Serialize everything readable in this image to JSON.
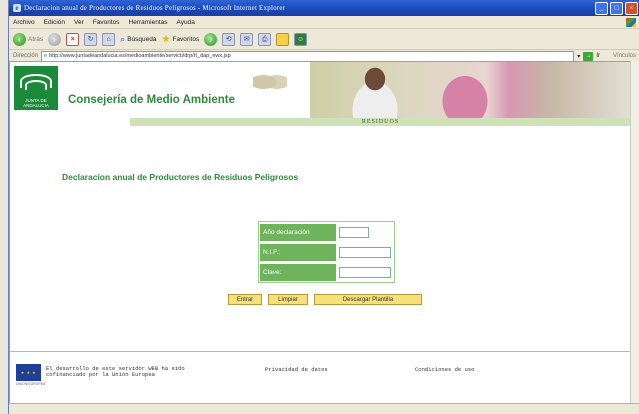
{
  "window": {
    "title": "Declaracion anual de Productores de Residuos Peligrosos - Microsoft Internet Explorer",
    "buttons": {
      "minimize": "_",
      "maximize": "□",
      "close": "×"
    }
  },
  "menu": [
    "Archivo",
    "Edición",
    "Ver",
    "Favoritos",
    "Herramientas",
    "Ayuda"
  ],
  "toolbar": {
    "back_label": "Atrás",
    "search_label": "Búsqueda",
    "favorites_label": "Favoritos"
  },
  "address": {
    "label": "Dirección",
    "url": "http://www.juntadeandalucia.es/medioambiente/servicti/drp/rt_dap_ewx.jsp",
    "go_label": "Ir",
    "links_label": "Vínculos"
  },
  "banner": {
    "logo_text": "JUNTA DE ANDALUCIA",
    "department": "Consejería de Medio Ambiente",
    "section": "RESIDUOS"
  },
  "page": {
    "heading": "Declaracion anual de Productores de Residuos Peligrosos"
  },
  "form": {
    "fields": [
      {
        "label": "Año declaración",
        "value": ""
      },
      {
        "label": "N.I.F.:",
        "value": ""
      },
      {
        "label": "Clave:",
        "value": ""
      }
    ],
    "buttons": {
      "submit": "Entrar",
      "reset": "Limpiar",
      "download": "Descargar Plantilla"
    }
  },
  "footer": {
    "eu_text": "El desarrollo de este servidor WEB ha sido cofinanciado por la Unión Europea",
    "eu_flag_label": "UNION EUROPEA",
    "privacy": "Privacidad de datos",
    "terms": "Condiciones de uso"
  }
}
